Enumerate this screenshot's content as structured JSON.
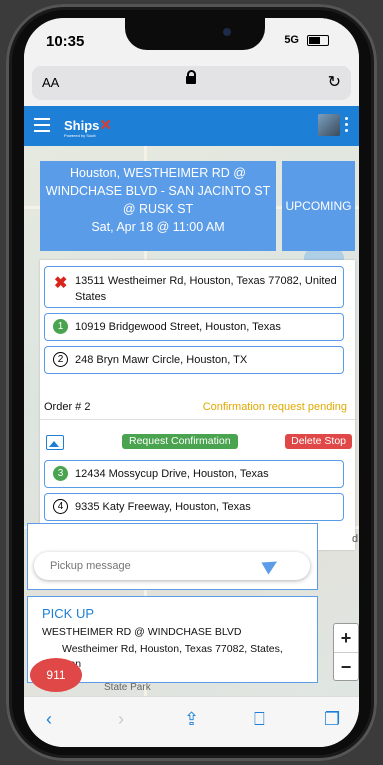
{
  "status": {
    "time": "10:35",
    "network": "5G"
  },
  "safari": {
    "aa_label": "AA"
  },
  "app": {
    "logo": "Ships",
    "logo_tagline": "Powered by Soutt"
  },
  "trip": {
    "line1": "Houston, WESTHEIMER RD @",
    "line2": "WINDCHASE BLVD - SAN JACINTO ST",
    "line3": "@ RUSK ST",
    "line4": "Sat, Apr 18 @ 11:00 AM",
    "status": "UPCOMING"
  },
  "stops": [
    {
      "marker": "x",
      "address": "13511 Westheimer Rd, Houston, Texas 77082, United States"
    },
    {
      "marker": "1",
      "address": "10919 Bridgewood Street, Houston, Texas"
    },
    {
      "marker": "2",
      "address": "248 Bryn Mawr Circle, Houston, TX"
    },
    {
      "marker": "3",
      "address": "12434 Mossycup Drive, Houston, Texas"
    },
    {
      "marker": "4",
      "address": "9335 Katy Freeway, Houston, Texas"
    }
  ],
  "order": {
    "label": "Order # 2",
    "status": "Confirmation request pending",
    "request_button": "Request Confirmation",
    "delete_button": "Delete Stop"
  },
  "message": {
    "placeholder": "Pickup message"
  },
  "pickup": {
    "title": "PICK UP",
    "street": "WESTHEIMER RD @ WINDCHASE BLVD",
    "address": "Westheimer Rd, Houston, Texas 77082, States, Houston"
  },
  "sos": {
    "label": "911"
  },
  "map": {
    "zoom_in": "+",
    "zoom_out": "−",
    "label_state_park": "State Park",
    "edge_label": "d"
  },
  "colors": {
    "primary": "#1d7fd6",
    "panel": "#5b9ce8",
    "success": "#4aa34f",
    "danger": "#e04848",
    "warning": "#e0a800"
  }
}
